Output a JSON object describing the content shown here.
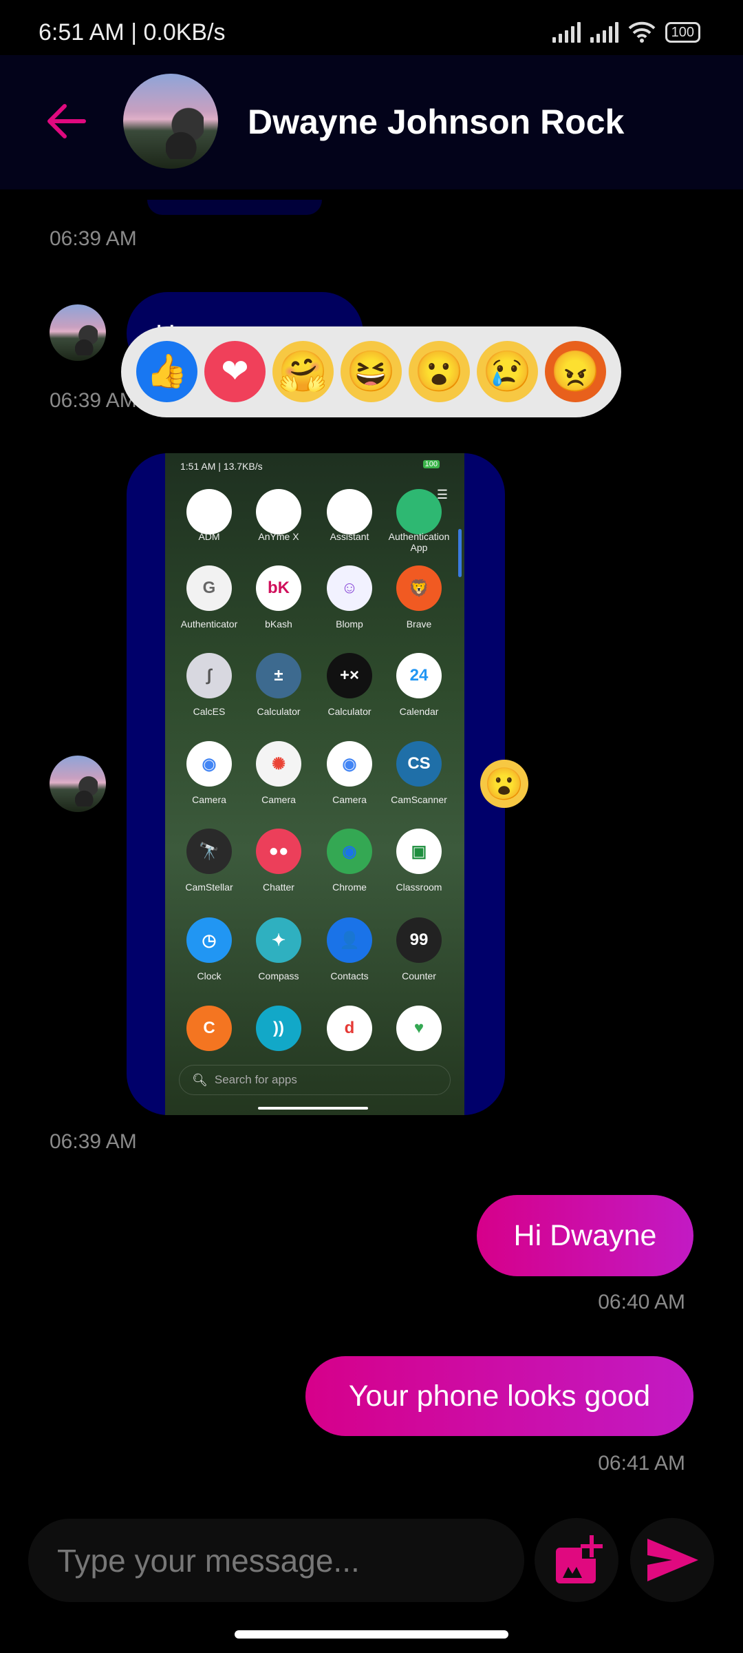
{
  "status_bar": {
    "time": "6:51 AM | 0.0KB/s",
    "battery": "100"
  },
  "header": {
    "contact_name": "Dwayne Johnson Rock",
    "back_icon": "arrow-left-icon"
  },
  "colors": {
    "accent": "#e0097f",
    "incoming_bubble": "#00005e",
    "outgoing_start": "#d6008a",
    "outgoing_end": "#c21ac4",
    "header_bg": "#03031a",
    "reaction_bar": "#e8e8e8"
  },
  "messages": [
    {
      "time": "06:39 AM"
    },
    {
      "text": "How are you",
      "time": "06:39 AM"
    },
    {
      "type": "image",
      "reaction": "wow",
      "time": "06:39 AM"
    },
    {
      "text": "Hi Dwayne",
      "time": "06:40 AM"
    },
    {
      "text": "Your phone looks good",
      "time": "06:41 AM"
    }
  ],
  "reactions": [
    {
      "name": "like",
      "glyph": "👍",
      "bg": "#1877f2"
    },
    {
      "name": "love",
      "glyph": "❤",
      "bg": "#f0405a"
    },
    {
      "name": "care",
      "glyph": "🤗",
      "bg": "#f7c843"
    },
    {
      "name": "haha",
      "glyph": "😆",
      "bg": "#f7c843"
    },
    {
      "name": "wow",
      "glyph": "😮",
      "bg": "#f7c843"
    },
    {
      "name": "sad",
      "glyph": "😢",
      "bg": "#f7c843"
    },
    {
      "name": "angry",
      "glyph": "😠",
      "bg": "#e8601c"
    }
  ],
  "shared_screenshot": {
    "status": "1:51 AM | 13.7KB/s",
    "battery": "100",
    "top_row": [
      "ADM",
      "AnYme X",
      "Assistant",
      "Authentication App"
    ],
    "apps": [
      {
        "label": "Authenticator",
        "color": "#f2f2f2",
        "glyph": "G",
        "fg": "#666"
      },
      {
        "label": "bKash",
        "color": "#ffffff",
        "glyph": "bK",
        "fg": "#d0105c"
      },
      {
        "label": "Blomp",
        "color": "#f2f2ff",
        "glyph": "☺",
        "fg": "#8a4ad8"
      },
      {
        "label": "Brave",
        "color": "#f15a22",
        "glyph": "🦁",
        "fg": "#fff"
      },
      {
        "label": "CalcES",
        "color": "#d8d8e0",
        "glyph": "∫",
        "fg": "#555"
      },
      {
        "label": "Calculator",
        "color": "#3d6a8f",
        "glyph": "±",
        "fg": "#fff"
      },
      {
        "label": "Calculator",
        "color": "#111111",
        "glyph": "+×",
        "fg": "#fff"
      },
      {
        "label": "Calendar",
        "color": "#ffffff",
        "glyph": "24",
        "fg": "#2196f3"
      },
      {
        "label": "Camera",
        "color": "#ffffff",
        "glyph": "◉",
        "fg": "#4285f4"
      },
      {
        "label": "Camera",
        "color": "#f4f4f4",
        "glyph": "✺",
        "fg": "#ea4335"
      },
      {
        "label": "Camera",
        "color": "#ffffff",
        "glyph": "◉",
        "fg": "#4285f4"
      },
      {
        "label": "CamScanner",
        "color": "#1f6fa8",
        "glyph": "CS",
        "fg": "#fff"
      },
      {
        "label": "CamStellar",
        "color": "#2a2a2a",
        "glyph": "🔭",
        "fg": "#fff"
      },
      {
        "label": "Chatter",
        "color": "#ec3f5a",
        "glyph": "●●",
        "fg": "#fff"
      },
      {
        "label": "Chrome",
        "color": "#34a853",
        "glyph": "◉",
        "fg": "#1a73e8"
      },
      {
        "label": "Classroom",
        "color": "#ffffff",
        "glyph": "▣",
        "fg": "#1e8e3e"
      },
      {
        "label": "Clock",
        "color": "#2196f3",
        "glyph": "◷",
        "fg": "#fff"
      },
      {
        "label": "Compass",
        "color": "#2fb0c0",
        "glyph": "✦",
        "fg": "#fff"
      },
      {
        "label": "Contacts",
        "color": "#1a73e8",
        "glyph": "👤",
        "fg": "#fff"
      },
      {
        "label": "Counter",
        "color": "#222222",
        "glyph": "99",
        "fg": "#fff"
      },
      {
        "label": "",
        "color": "#f47521",
        "glyph": "C",
        "fg": "#fff"
      },
      {
        "label": "",
        "color": "#12a8c8",
        "glyph": "))",
        "fg": "#fff"
      },
      {
        "label": "",
        "color": "#ffffff",
        "glyph": "d",
        "fg": "#e53935"
      },
      {
        "label": "",
        "color": "#ffffff",
        "glyph": "♥",
        "fg": "#34a853"
      }
    ],
    "search_placeholder": "Search for apps"
  },
  "composer": {
    "placeholder": "Type your message...",
    "image_icon": "add-photo-icon",
    "send_icon": "send-icon"
  }
}
